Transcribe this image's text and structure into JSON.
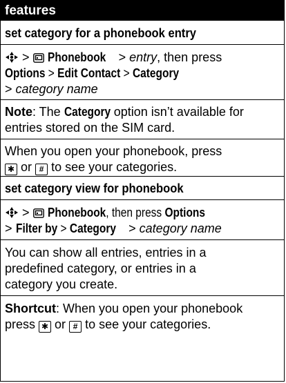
{
  "header": {
    "title": "features"
  },
  "section1": {
    "title": "set category for a phonebook entry",
    "path": {
      "sep": ">",
      "phonebook": "Phonebook",
      "sep2": ">",
      "entry": "entry",
      "then_press": ", then press",
      "options": "Options",
      "sep3": ">",
      "edit_contact": "Edit Contact",
      "sep4": ">",
      "category": "Category",
      "sep5": ">",
      "category_name": "category name"
    },
    "note": {
      "label": "Note",
      "colon": ": The",
      "category": "Category",
      "rest1": "option isn’t available for",
      "line2": "entries stored on the SIM card."
    },
    "open": {
      "line1": "When you open your phonebook, press",
      "or": "or",
      "rest": "to see your categories."
    }
  },
  "section2": {
    "title": "set category view for phonebook",
    "path": {
      "sep": ">",
      "phonebook": "Phonebook",
      "then_press": ", then press",
      "options": "Options",
      "sep2": ">",
      "filter_by": "Filter by",
      "sep3": ">",
      "category": "Category",
      "sep4": ">",
      "category_name": "category name"
    },
    "desc": {
      "line1": "You can show all entries, entries in a",
      "line2": "predefined category, or entries in a",
      "line3": "category you create."
    },
    "shortcut": {
      "label": "Shortcut",
      "line1rest": ": When you open your phonebook",
      "line2a": "press",
      "or": "or",
      "line2b": "to see your categories."
    }
  },
  "keys": {
    "star": "✱",
    "hash": "#"
  }
}
